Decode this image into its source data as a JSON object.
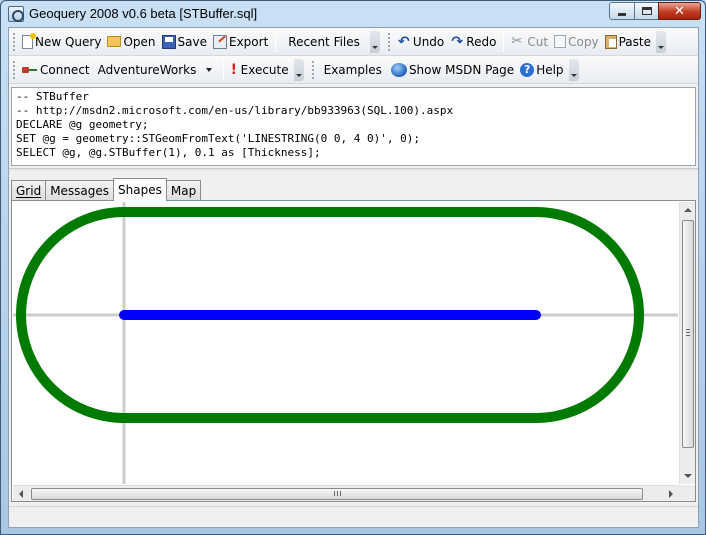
{
  "window": {
    "title": "Geoquery 2008 v0.6 beta [STBuffer.sql]"
  },
  "toolbar1": {
    "new_query": "New Query",
    "open": "Open",
    "save": "Save",
    "export": "Export",
    "recent_files": "Recent Files",
    "undo": "Undo",
    "redo": "Redo",
    "cut": "Cut",
    "copy": "Copy",
    "paste": "Paste"
  },
  "toolbar2": {
    "connect": "Connect",
    "database": "AdventureWorks",
    "execute": "Execute",
    "examples": "Examples",
    "show_msdn": "Show MSDN Page",
    "help": "Help"
  },
  "editor": {
    "lines": [
      "-- STBuffer",
      "-- http://msdn2.microsoft.com/en-us/library/bb933963(SQL.100).aspx",
      "DECLARE @g geometry;",
      "SET @g = geometry::STGeomFromText('LINESTRING(0 0, 4 0)', 0);",
      "SELECT @g, @g.STBuffer(1), 0.1 as [Thickness];"
    ]
  },
  "tabs": [
    {
      "label": "Grid",
      "active": false
    },
    {
      "label": "Messages",
      "active": false
    },
    {
      "label": "Shapes",
      "active": true
    },
    {
      "label": "Map",
      "active": false
    }
  ],
  "shapes": {
    "linestring": {
      "points": [
        [
          0,
          0
        ],
        [
          4,
          0
        ]
      ],
      "color": "#0000ff"
    },
    "buffer": {
      "distance": 1,
      "color": "#007a00"
    },
    "axis_color": "#cccccc"
  },
  "icons": {
    "new_query": "new-document-icon",
    "open": "folder-open-icon",
    "save": "floppy-disk-icon",
    "export": "export-icon",
    "undo": "undo-arrow-icon",
    "redo": "redo-arrow-icon",
    "cut": "scissors-icon",
    "copy": "copy-icon",
    "paste": "clipboard-icon",
    "connect": "plug-icon",
    "execute": "exclamation-icon",
    "msdn": "globe-icon",
    "help": "question-icon"
  }
}
